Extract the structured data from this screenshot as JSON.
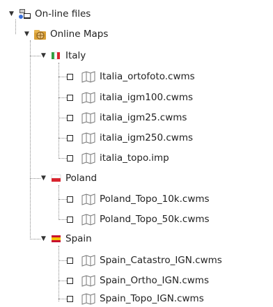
{
  "tree": {
    "root": {
      "label": "On-line files",
      "icon": "network-folder-icon"
    },
    "online_maps": {
      "label": "Online Maps",
      "icon": "globe-folder-icon"
    },
    "groups": [
      {
        "label": "Italy",
        "icon": "italy-flag-icon",
        "flag_colors": [
          "#2e9e3e",
          "#ffffff",
          "#d9242e"
        ],
        "items": [
          "Italia_ortofoto.cwms",
          "italia_igm100.cwms",
          "italia_igm25.cwms",
          "italia_igm250.cwms",
          "italia_topo.imp"
        ]
      },
      {
        "label": "Poland",
        "icon": "poland-flag-icon",
        "flag_colors": [
          "#ffffff",
          "#d9242e"
        ],
        "items": [
          "Poland_Topo_10k.cwms",
          "Poland_Topo_50k.cwms"
        ]
      },
      {
        "label": "Spain",
        "icon": "spain-flag-icon",
        "flag_colors": [
          "#c8102e",
          "#f5c400",
          "#c8102e"
        ],
        "items": [
          "Spain_Catastro_IGN.cwms",
          "Spain_Ortho_IGN.cwms",
          "Spain_Topo_IGN.cwms"
        ]
      }
    ]
  }
}
